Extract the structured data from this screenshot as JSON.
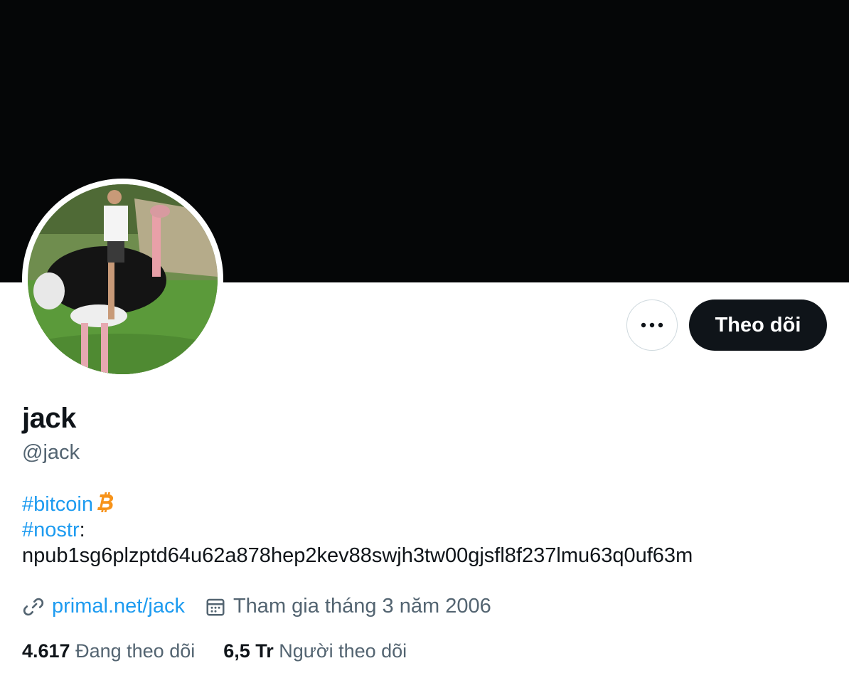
{
  "profile": {
    "name": "jack",
    "handle": "@jack",
    "follow_label": "Theo dõi"
  },
  "bio": {
    "line1_tag": "#bitcoin",
    "line2_tag": "#nostr",
    "line2_sep": ":",
    "npub": "npub1sg6plzptd64u62a878hep2kev88swjh3tw00gjsfl8f237lmu63q0uf63m"
  },
  "meta": {
    "website": "primal.net/jack",
    "joined": "Tham gia tháng 3 năm 2006"
  },
  "stats": {
    "following_count": "4.617",
    "following_label": "Đang theo dõi",
    "followers_count": "6,5 Tr",
    "followers_label": "Người theo dõi"
  },
  "colors": {
    "accent": "#1d9bf0",
    "bitcoin": "#f7931a",
    "banner": "#050607"
  },
  "icons": [
    "more-icon",
    "bitcoin-icon",
    "link-icon",
    "calendar-icon"
  ]
}
